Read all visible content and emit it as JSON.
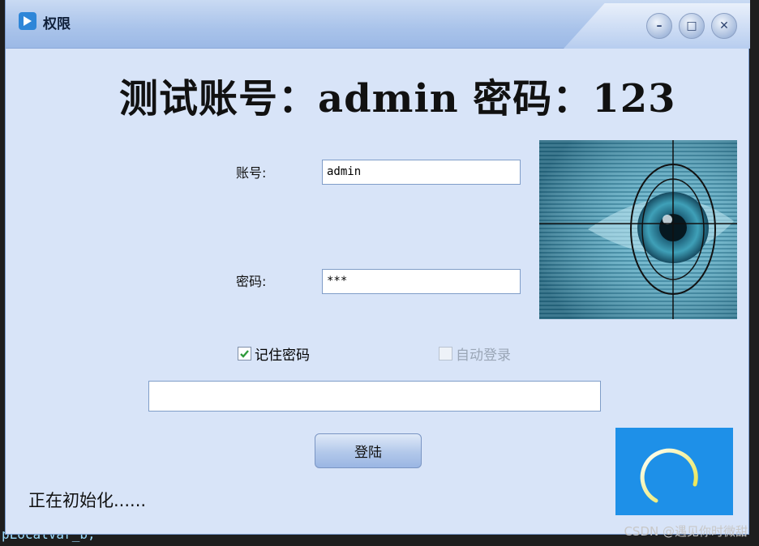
{
  "window": {
    "title": "权限",
    "controls": [
      "minimize",
      "maximize",
      "close"
    ],
    "minimize_glyph": "–",
    "maximize_glyph": "□",
    "close_glyph": "✕"
  },
  "headline": "测试账号：admin 密码：123",
  "form": {
    "account_label": "账号:",
    "account_value": "admin",
    "password_label": "密码:",
    "password_value": "***",
    "remember_label": "记住密码",
    "remember_checked": true,
    "autologin_label": "自动登录",
    "autologin_checked": false,
    "status_field_value": "",
    "login_button": "登陆"
  },
  "status_text": "正在初始化......",
  "background": {
    "editor_fragment": "pLocalVar_b;",
    "watermark": "CSDN @遇见你时微甜"
  },
  "colors": {
    "spinner_bg": "#1e90e8",
    "window_bg": "#d8e4f8"
  },
  "icons": [
    "app-icon",
    "eye-scan-image",
    "loading-spinner-icon",
    "checkmark-icon"
  ]
}
